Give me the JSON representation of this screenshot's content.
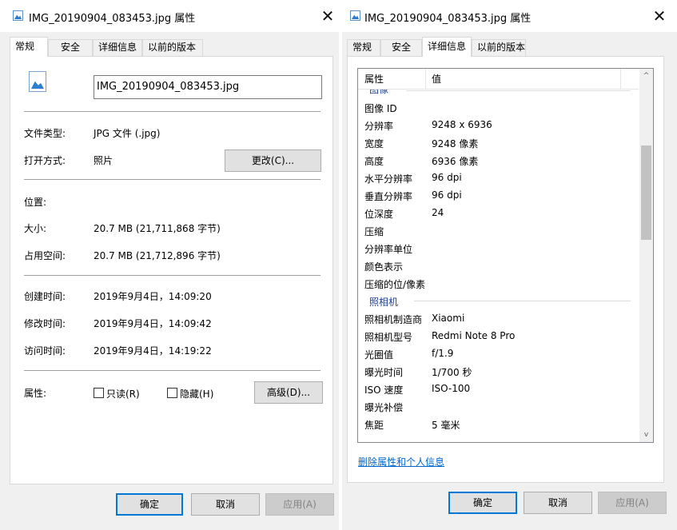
{
  "left_dialog": {
    "title": "IMG_20190904_083453.jpg 属性",
    "close_glyph": "✕",
    "tabs": [
      {
        "label": "常规",
        "active": true
      },
      {
        "label": "安全",
        "active": false
      },
      {
        "label": "详细信息",
        "active": false
      },
      {
        "label": "以前的版本",
        "active": false
      }
    ],
    "filename": "IMG_20190904_083453.jpg",
    "file_type": {
      "label": "文件类型:",
      "value": "JPG 文件 (.jpg)"
    },
    "open_with": {
      "label": "打开方式:",
      "value": "照片",
      "change_button": "更改(C)..."
    },
    "location": {
      "label": "位置:",
      "value": ""
    },
    "size": {
      "label": "大小:",
      "value": "20.7 MB (21,711,868 字节)"
    },
    "size_on_disk": {
      "label": "占用空间:",
      "value": "20.7 MB (21,712,896 字节)"
    },
    "created": {
      "label": "创建时间:",
      "value": "2019年9月4日，14:09:20"
    },
    "modified": {
      "label": "修改时间:",
      "value": "2019年9月4日，14:09:42"
    },
    "accessed": {
      "label": "访问时间:",
      "value": "2019年9月4日，14:19:22"
    },
    "attributes": {
      "label": "属性:",
      "readonly": "只读(R)",
      "hidden": "隐藏(H)",
      "advanced_button": "高级(D)..."
    },
    "buttons": {
      "ok": "确定",
      "cancel": "取消",
      "apply": "应用(A)"
    }
  },
  "right_dialog": {
    "title": "IMG_20190904_083453.jpg 属性",
    "close_glyph": "✕",
    "tabs": [
      {
        "label": "常规",
        "active": false
      },
      {
        "label": "安全",
        "active": false
      },
      {
        "label": "详细信息",
        "active": true
      },
      {
        "label": "以前的版本",
        "active": false
      }
    ],
    "columns": {
      "property": "属性",
      "value": "值"
    },
    "partial_group": "图像",
    "rows_image": [
      {
        "prop": "图像 ID",
        "val": ""
      },
      {
        "prop": "分辨率",
        "val": "9248 x 6936"
      },
      {
        "prop": "宽度",
        "val": "9248 像素"
      },
      {
        "prop": "高度",
        "val": "6936 像素"
      },
      {
        "prop": "水平分辨率",
        "val": "96 dpi"
      },
      {
        "prop": "垂直分辨率",
        "val": "96 dpi"
      },
      {
        "prop": "位深度",
        "val": "24"
      },
      {
        "prop": "压缩",
        "val": ""
      },
      {
        "prop": "分辨率单位",
        "val": ""
      },
      {
        "prop": "颜色表示",
        "val": ""
      },
      {
        "prop": "压缩的位/像素",
        "val": ""
      }
    ],
    "camera_group": "照相机",
    "rows_camera": [
      {
        "prop": "照相机制造商",
        "val": "Xiaomi"
      },
      {
        "prop": "照相机型号",
        "val": "Redmi Note 8 Pro"
      },
      {
        "prop": "光圈值",
        "val": "f/1.9"
      },
      {
        "prop": "曝光时间",
        "val": "1/700 秒"
      },
      {
        "prop": "ISO 速度",
        "val": "ISO-100"
      },
      {
        "prop": "曝光补偿",
        "val": ""
      },
      {
        "prop": "焦距",
        "val": "5 毫米"
      }
    ],
    "scroll_up": "^",
    "scroll_down": "v",
    "remove_link": "删除属性和个人信息",
    "buttons": {
      "ok": "确定",
      "cancel": "取消",
      "apply": "应用(A)"
    }
  }
}
